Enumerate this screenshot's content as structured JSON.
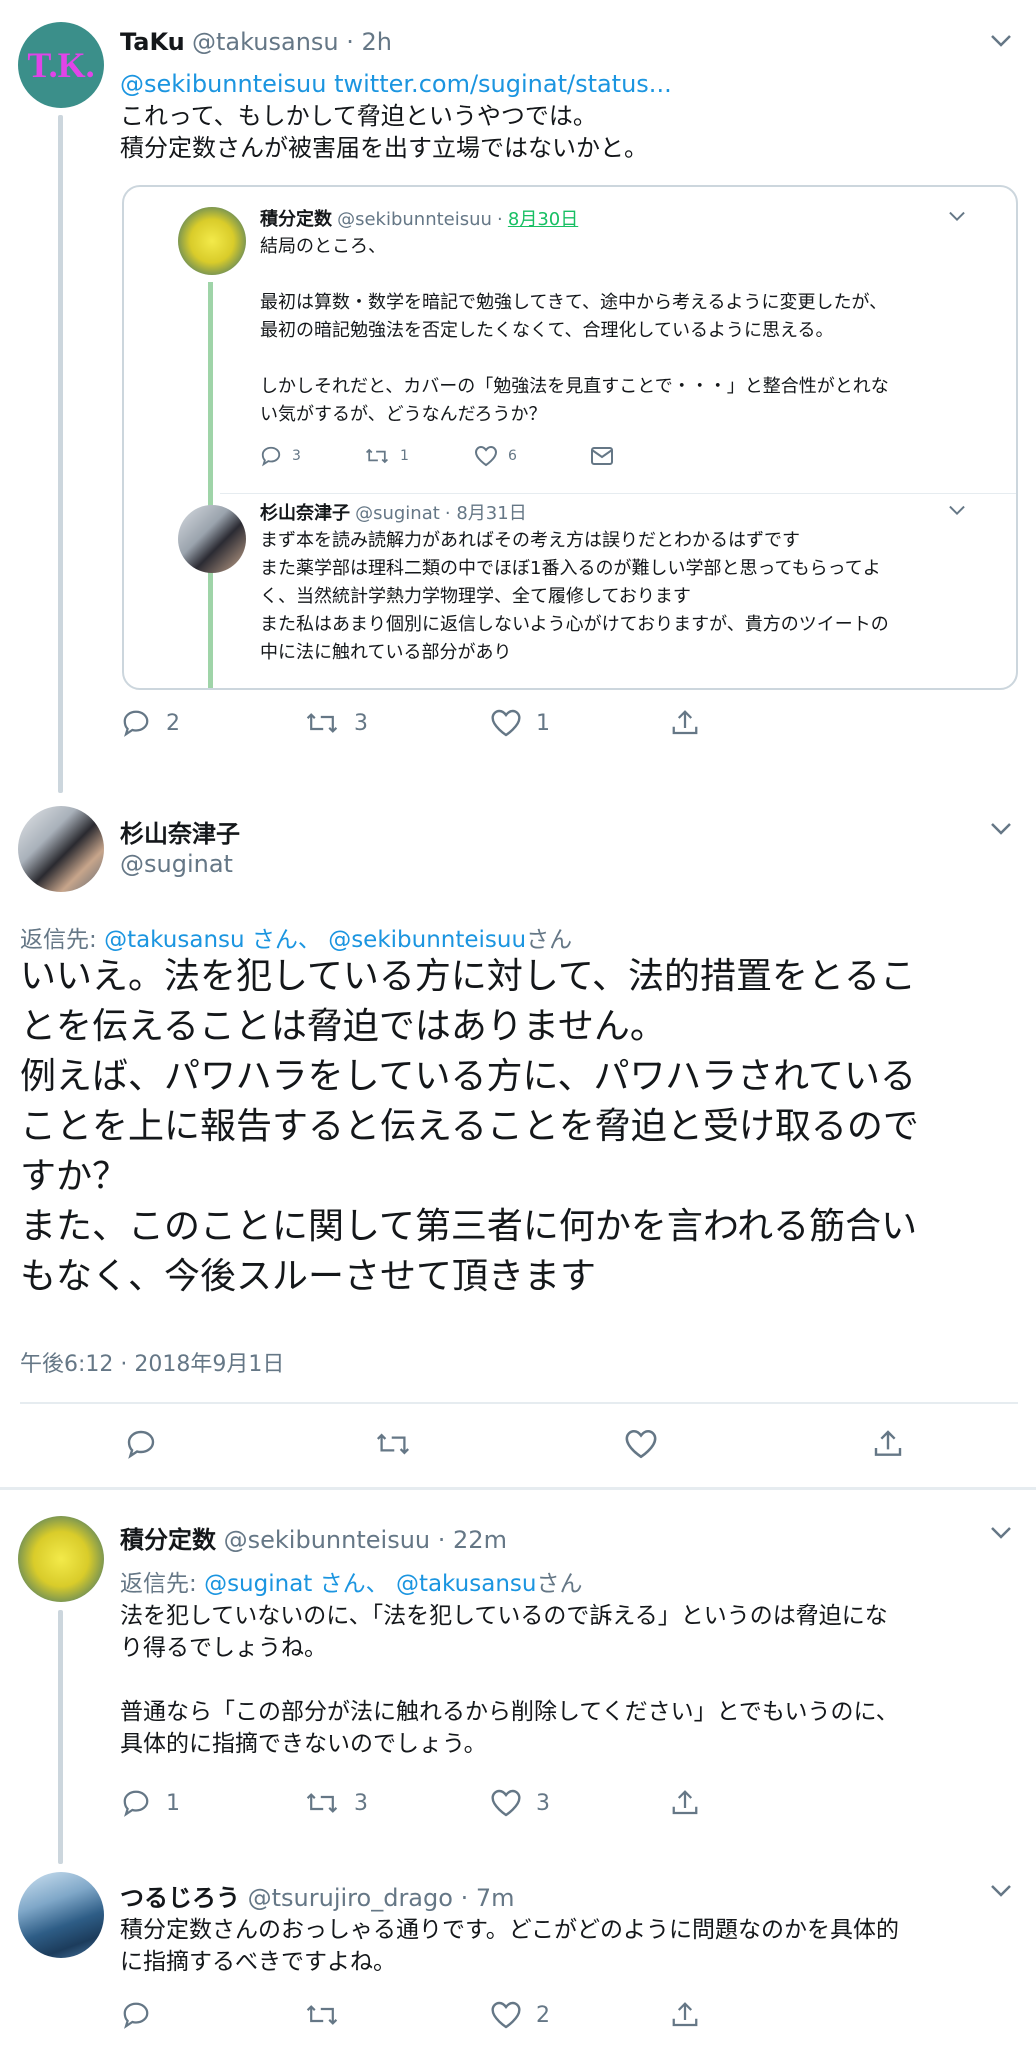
{
  "colors": {
    "link": "#1b95e0",
    "muted": "#657786",
    "line": "#ccd6dd",
    "thread_green": "#9fd4a8"
  },
  "tweet1": {
    "name": "TaKu",
    "handle": "@takusansu",
    "time": "· 2h",
    "avatar_text": "T.K.",
    "link_text": "@sekibunnteisuu twitter.com/suginat/status...",
    "lines": [
      "これって、もしかして脅迫というやつでは。",
      "積分定数さんが被害届を出す立場ではないかと。"
    ],
    "actions": {
      "reply": "2",
      "retweet": "3",
      "like": "1"
    }
  },
  "quote": {
    "first": {
      "name": "積分定数",
      "handle": "@sekibunnteisuu",
      "time_prefix": "·",
      "time": "8月30日",
      "text": "結局のところ、\n\n最初は算数・数学を暗記で勉強してきて、途中から考えるように変更したが、\n最初の暗記勉強法を否定したくなくて、合理化しているように思える。\n\nしかしそれだと、カバーの「勉強法を見直すことで・・・」と整合性がとれな\nい気がするが、どうなんだろうか？",
      "actions": {
        "reply": "3",
        "retweet": "1",
        "like": "6"
      }
    },
    "second": {
      "name": "杉山奈津子",
      "handle": "@suginat",
      "time": "· 8月31日",
      "text": "まず本を読み読解力があればその考え方は誤りだとわかるはずです\nまた薬学部は理科二類の中でほぼ1番入るのが難しい学部と思ってもらってよ\nく、当然統計学熱力学物理学、全て履修しております\nまた私はあまり個別に返信しないよう心がけておりますが、貴方のツイートの\n中に法に触れている部分があり"
    }
  },
  "main": {
    "name": "杉山奈津子",
    "handle": "@suginat",
    "reply_label": "返信先:",
    "reply_to_1": "@takusansu さん、",
    "reply_to_2": "@sekibunnteisuu",
    "reply_suffix": "さん",
    "lines": [
      "いいえ。法を犯している方に対して、法的措置をとるこ",
      "とを伝えることは脅迫ではありません。",
      "例えば、パワハラをしている方に、パワハラされている",
      "ことを上に報告すると伝えることを脅迫と受け取るので",
      "すか？",
      "また、このことに関して第三者に何かを言われる筋合い",
      "もなく、今後スルーさせて頂きます"
    ],
    "timestamp": "午後6:12 · 2018年9月1日"
  },
  "reply1": {
    "name": "積分定数",
    "handle": "@sekibunnteisuu",
    "time": "· 22m",
    "reply_label": "返信先:",
    "reply_to_1": "@suginat さん、",
    "reply_to_2": "@takusansu",
    "reply_suffix": "さん",
    "lines": [
      "法を犯していないのに、「法を犯しているので訴える」というのは脅迫にな",
      "り得るでしょうね。",
      "",
      "普通なら「この部分が法に触れるから削除してください」とでもいうのに、",
      "具体的に指摘できないのでしょう。"
    ],
    "actions": {
      "reply": "1",
      "retweet": "3",
      "like": "3"
    }
  },
  "reply2": {
    "name": "つるじろう",
    "handle": "@tsurujiro_drago",
    "time": "· 7m",
    "lines": [
      "積分定数さんのおっしゃる通りです。どこがどのように問題なのかを具体的",
      "に指摘するべきですよね。"
    ],
    "actions": {
      "like": "2"
    }
  }
}
